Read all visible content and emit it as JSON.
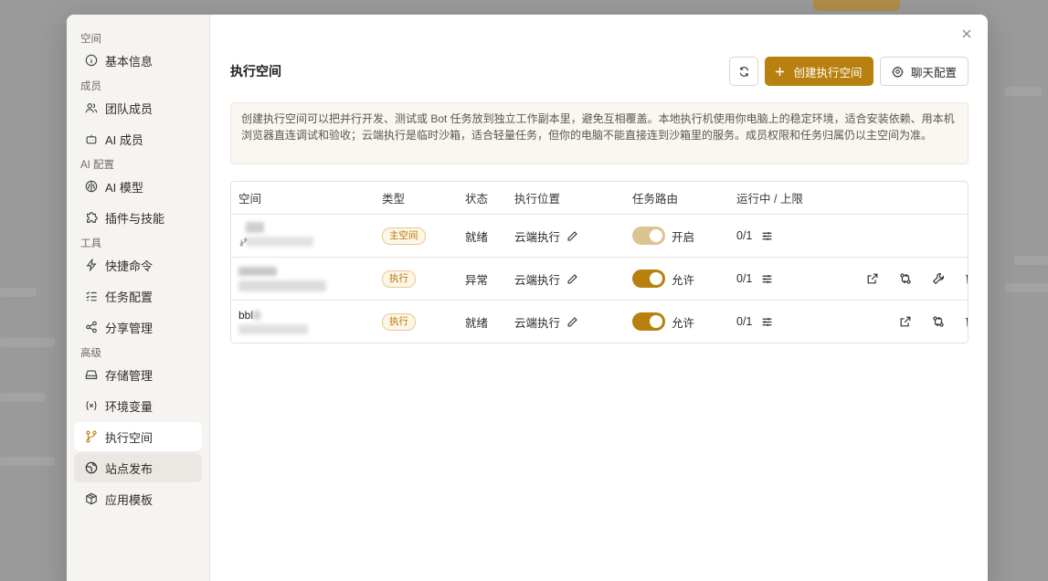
{
  "sidebar": {
    "sections": [
      {
        "title": "空间",
        "items": [
          {
            "label": "基本信息",
            "icon": "info-icon"
          }
        ]
      },
      {
        "title": "成员",
        "items": [
          {
            "label": "团队成员",
            "icon": "users-icon"
          },
          {
            "label": "AI 成员",
            "icon": "bot-icon"
          }
        ]
      },
      {
        "title": "AI 配置",
        "items": [
          {
            "label": "AI 模型",
            "icon": "brain-icon"
          },
          {
            "label": "插件与技能",
            "icon": "puzzle-icon"
          }
        ]
      },
      {
        "title": "工具",
        "items": [
          {
            "label": "快捷命令",
            "icon": "bolt-icon"
          },
          {
            "label": "任务配置",
            "icon": "list-check-icon"
          },
          {
            "label": "分享管理",
            "icon": "share-icon"
          }
        ]
      },
      {
        "title": "高级",
        "items": [
          {
            "label": "存储管理",
            "icon": "drive-icon"
          },
          {
            "label": "环境变量",
            "icon": "variable-icon"
          },
          {
            "label": "执行空间",
            "icon": "branch-icon",
            "active": true
          },
          {
            "label": "站点发布",
            "icon": "globe-icon"
          },
          {
            "label": "应用模板",
            "icon": "package-icon"
          }
        ]
      }
    ]
  },
  "main": {
    "title": "执行空间",
    "create_label": "创建执行空间",
    "chat_config_label": "聊天配置",
    "notice": "创建执行空间可以把并行开发、测试或 Bot 任务放到独立工作副本里，避免互相覆盖。本地执行机使用你电脑上的稳定环境，适合安装依赖、用本机浏览器直连调试和验收；云端执行是临时沙箱，适合轻量任务，但你的电脑不能直接连到沙箱里的服务。成员权限和任务归属仍以主空间为准。"
  },
  "table": {
    "headers": {
      "space": "空间",
      "type": "类型",
      "status": "状态",
      "location": "执行位置",
      "routing": "任务路由",
      "running": "运行中 / 上限"
    },
    "rows": [
      {
        "name": "",
        "type": "主空间",
        "status": "就绪",
        "location": "云端执行",
        "routing": "开启",
        "routing_on": true,
        "running": "0/1",
        "actions": []
      },
      {
        "name": "",
        "type": "执行",
        "status": "异常",
        "location": "云端执行",
        "routing": "允许",
        "routing_on": true,
        "running": "0/1",
        "actions": [
          "open-external-icon",
          "sync-icon",
          "wrench-icon",
          "trash-icon"
        ]
      },
      {
        "name": "bbl",
        "type": "执行",
        "status": "就绪",
        "location": "云端执行",
        "routing": "允许",
        "routing_on": true,
        "running": "0/1",
        "actions": [
          "open-external-icon",
          "sync-icon",
          "trash-icon"
        ]
      }
    ]
  },
  "colors": {
    "accent": "#b8800f",
    "badge_text": "#b8760a",
    "sidebar_bg": "#f5f4f1"
  }
}
